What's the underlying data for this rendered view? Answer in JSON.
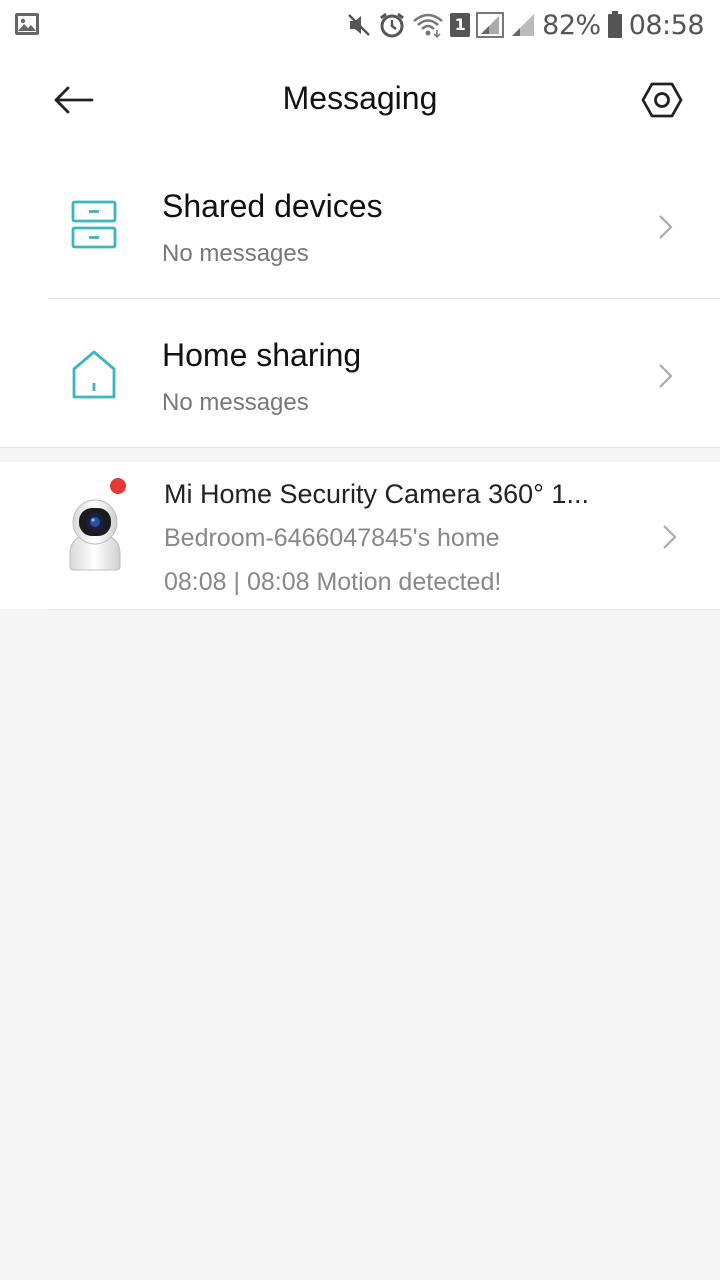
{
  "status_bar": {
    "battery_percent": "82%",
    "time": "08:58",
    "sim_badge": "1",
    "icons": [
      "gallery-icon",
      "mute-icon",
      "alarm-icon",
      "wifi-icon",
      "sim-icon",
      "signal-icon",
      "signal-weak-icon",
      "battery-icon"
    ]
  },
  "header": {
    "title": "Messaging",
    "back_icon": "arrow-left-icon",
    "settings_icon": "hexagon-settings-icon"
  },
  "colors": {
    "accent_teal": "#3bb7bc",
    "unread_red": "#e53935",
    "background": "#f5f5f5"
  },
  "rows": [
    {
      "title": "Shared devices",
      "subtitle": "No messages",
      "icon": "shared-devices-icon"
    },
    {
      "title": "Home sharing",
      "subtitle": "No messages",
      "icon": "home-icon"
    }
  ],
  "device_message": {
    "title": "Mi Home Security Camera 360° 1...",
    "home": "Bedroom-6466047845's home",
    "event": "08:08 | 08:08 Motion detected!",
    "icon": "security-camera-icon"
  }
}
